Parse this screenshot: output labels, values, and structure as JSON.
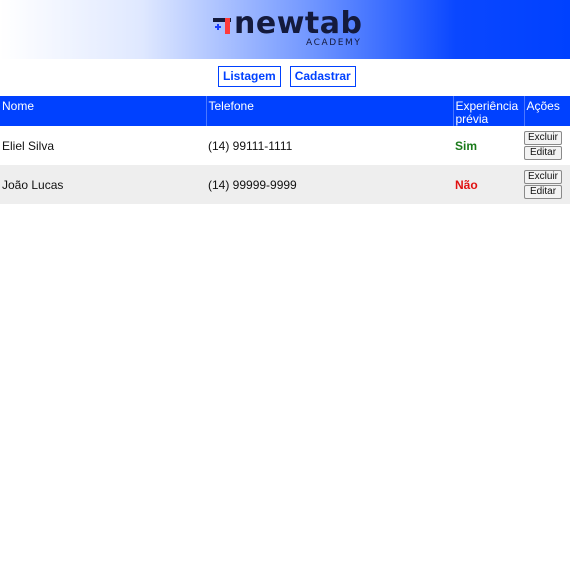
{
  "brand": {
    "name": "newtab",
    "sub": "ACADEMY",
    "colors": {
      "primary": "#0041ff",
      "dark": "#141a3c",
      "accent_red": "#ff3b3b"
    }
  },
  "nav": {
    "items": [
      {
        "label": "Listagem"
      },
      {
        "label": "Cadastrar"
      }
    ]
  },
  "table": {
    "headers": [
      "Nome",
      "Telefone",
      "Experiência prévia",
      "Ações"
    ],
    "rows": [
      {
        "nome": "Eliel Silva",
        "telefone": "(14) 99111-1111",
        "experiencia": "Sim",
        "delete_label": "Excluir",
        "edit_label": "Editar"
      },
      {
        "nome": "João Lucas",
        "telefone": "(14) 99999-9999",
        "experiencia": "Não",
        "delete_label": "Excluir",
        "edit_label": "Editar"
      }
    ],
    "status_colors": {
      "sim": "#1a7a1a",
      "nao": "#e01010"
    }
  }
}
